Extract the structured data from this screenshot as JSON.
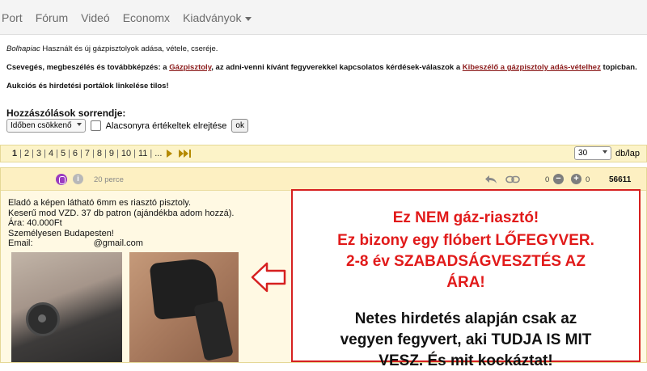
{
  "nav": {
    "items": [
      "Port",
      "Fórum",
      "Videó",
      "Economx",
      "Kiadványok"
    ]
  },
  "intro": {
    "desc_italic": "Bolhapiac",
    "desc_rest": " Használt és új gázpisztolyok adása, vétele, cseréje.",
    "chat_prefix": "Csevegés, megbeszélés és továbbképzés: a ",
    "chat_link1": "Gázpisztoly",
    "chat_mid": ", az adni-venni kívánt fegyverekkel kapcsolatos kérdések-válaszok a ",
    "chat_link2": "Kibeszélő a gázpisztoly adás-vételhez",
    "chat_suffix": " topicban.",
    "auction_note": "Aukciós és hirdetési portálok linkelése tilos!"
  },
  "sort": {
    "title": "Hozzászólások sorrendje:",
    "selected": "Időben csökkenő",
    "hide_label": "Alacsonyra értékeltek elrejtése",
    "ok_label": "ok"
  },
  "pager": {
    "current": "1",
    "pages": [
      "2",
      "3",
      "4",
      "5",
      "6",
      "7",
      "8",
      "9",
      "10",
      "11"
    ],
    "ellipsis": "...",
    "per_page_value": "30",
    "per_page_unit": "db/lap"
  },
  "post": {
    "time": "20 perce",
    "info_glyph": "i",
    "minus_count": "0",
    "minus_glyph": "−",
    "plus_glyph": "+",
    "plus_count": "0",
    "number": "56611",
    "body_lines": [
      "Eladó a képen látható 6mm es riasztó pisztoly.",
      "Keserű mod VZD. 37 db patron (ajándékba adom hozzá).",
      "Ára: 40.000Ft",
      "Személyesen Budapesten!"
    ],
    "email_label": "Email:",
    "email_domain": "@gmail.com"
  },
  "warning": {
    "line1": "Ez NEM gáz-riasztó!",
    "line2": "Ez bizony egy flóbert LŐFEGYVER.",
    "line3": "2-8 év SZABADSÁGVESZTÉS AZ",
    "line4": "ÁRA!",
    "line5": "Netes hirdetés alapján csak az",
    "line6": "vegyen fegyvert, aki TUDJA IS MIT",
    "line7": "VESZ. És mit kockáztat!",
    "text_color": "#e11a1a",
    "border_color": "#d62020"
  }
}
